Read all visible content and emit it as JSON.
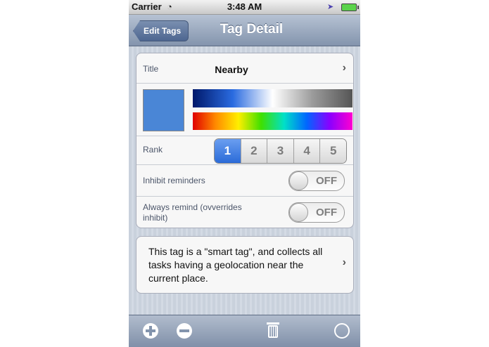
{
  "status_bar": {
    "carrier": "Carrier",
    "time": "3:48 AM"
  },
  "nav": {
    "back_label": "Edit Tags",
    "title": "Tag Detail"
  },
  "detail": {
    "title_label": "Title",
    "title_value": "Nearby",
    "color_selected": "#4a86d6",
    "rank_label": "Rank",
    "rank_options": [
      "1",
      "2",
      "3",
      "4",
      "5"
    ],
    "rank_selected": "1",
    "inhibit_label": "Inhibit reminders",
    "inhibit_value": "OFF",
    "always_label": "Always remind (ovverrides inhibit)",
    "always_value": "OFF"
  },
  "description": "This tag is a \"smart tag\", and collects all tasks having a geolocation near the current place.",
  "toolbar": {
    "icons": [
      "add-icon",
      "remove-icon",
      "trash-icon",
      "circle-icon"
    ]
  }
}
